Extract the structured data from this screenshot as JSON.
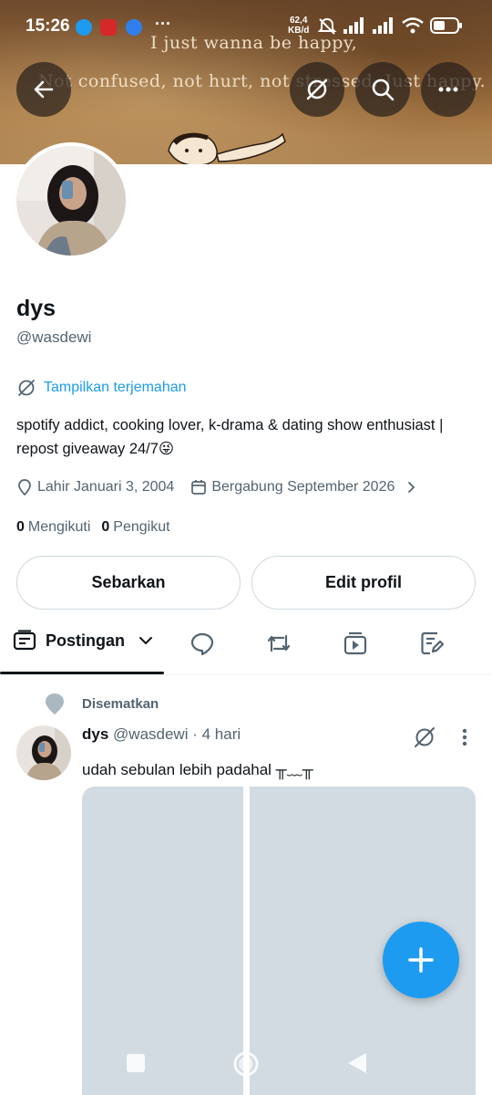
{
  "status_bar": {
    "time": "15:26",
    "net_speed_value": "62,4",
    "net_speed_unit": "KB/d",
    "overflow": "···"
  },
  "banner": {
    "line1": "I just wanna be happy,",
    "line2": "Not confused, not hurt, not stressed. Just happy."
  },
  "profile": {
    "name": "dys",
    "handle": "@wasdewi",
    "translate_label": "Tampilkan terjemahan",
    "bio": "spotify addict, cooking lover, k-drama & dating show enthusiast | repost giveaway 24/7😜",
    "birth": "Lahir Januari 3, 2004",
    "joined": "Bergabung September 2026",
    "following_count": "0",
    "following_label": "Mengikuti",
    "followers_count": "0",
    "followers_label": "Pengikut"
  },
  "buttons": {
    "share": "Sebarkan",
    "edit": "Edit profil"
  },
  "tabs": {
    "active": "Postingan"
  },
  "pinned_tweet": {
    "pinned_label": "Disematkan",
    "name": "dys",
    "handle": "@wasdewi",
    "time": "· 4 hari",
    "text": "udah sebulan lebih padahal ╥﹏╥"
  },
  "colors": {
    "accent": "#1d9bf0",
    "text": "#0f1419",
    "muted": "#536471",
    "border": "#cfd9de"
  },
  "icons": [
    "back-icon",
    "grok-icon",
    "search-icon",
    "more-icon",
    "location-icon",
    "calendar-icon",
    "chevron-right-icon",
    "chevron-down-icon",
    "reply-icon",
    "repost-icon",
    "media-icon",
    "article-icon",
    "pin-icon",
    "plus-icon"
  ]
}
